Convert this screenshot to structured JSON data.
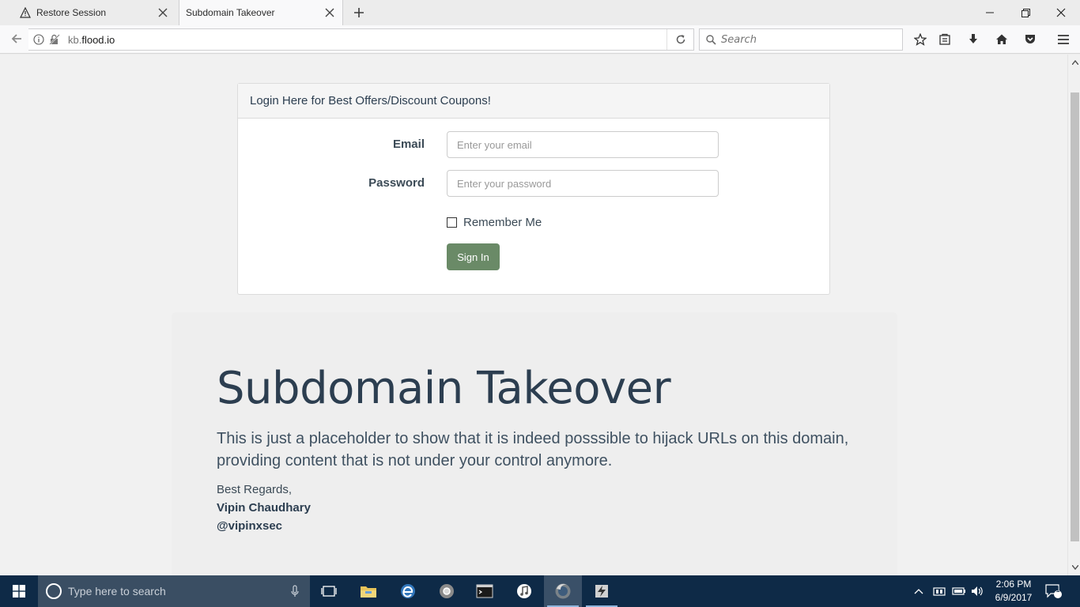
{
  "browser": {
    "tabs": [
      {
        "title": "Restore Session",
        "active": false,
        "icon": "warning-icon"
      },
      {
        "title": "Subdomain Takeover",
        "active": true,
        "icon": "none"
      }
    ],
    "url_prefix": "kb.",
    "url_domain": "flood.io",
    "search_placeholder": "Search"
  },
  "page": {
    "panel_heading": "Login Here for Best Offers/Discount Coupons!",
    "email_label": "Email",
    "email_placeholder": "Enter your email",
    "password_label": "Password",
    "password_placeholder": "Enter your password",
    "remember_label": "Remember Me",
    "signin_label": "Sign In",
    "title": "Subdomain Takeover",
    "lead": "This is just a placeholder to show that it is indeed posssible to hijack URLs on this domain, providing content that is not under your control anymore.",
    "regards": "Best Regards,",
    "author": "Vipin Chaudhary",
    "handle": "@vipinxsec"
  },
  "taskbar": {
    "search_placeholder": "Type here to search",
    "time": "2:06 PM",
    "date": "6/9/2017",
    "notification_count": "1"
  },
  "colors": {
    "signin_button": "#6a8a67",
    "heading_text": "#2c3e50",
    "taskbar": "#0e2a47"
  }
}
